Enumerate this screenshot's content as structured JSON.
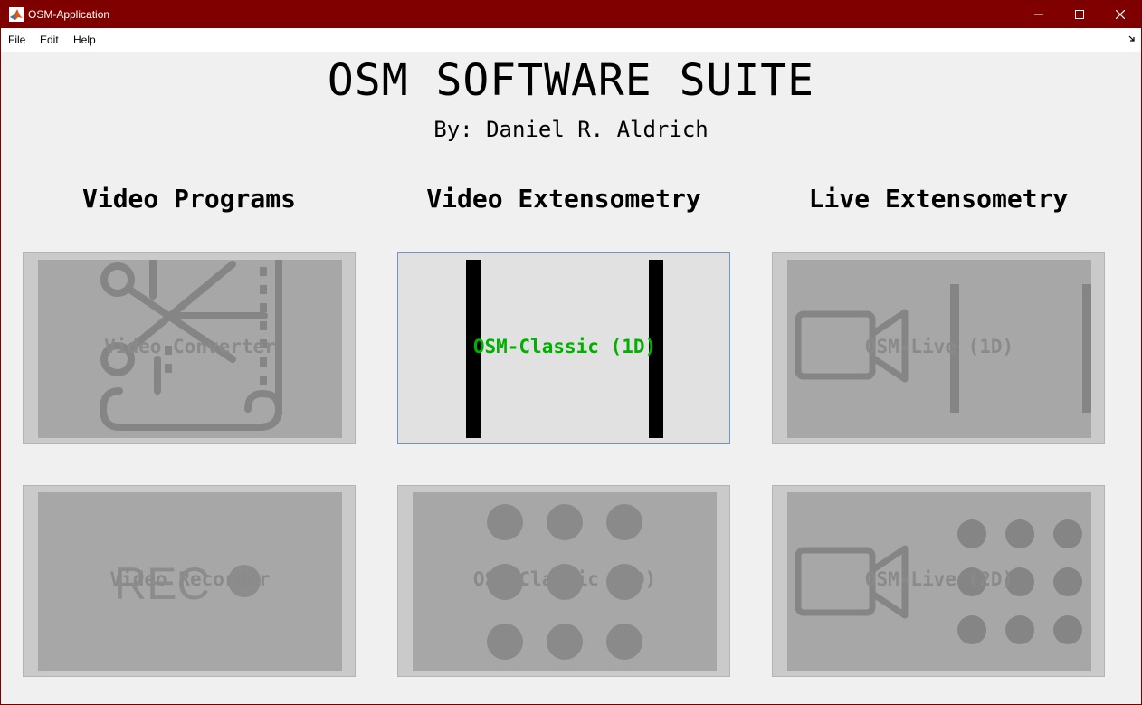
{
  "window": {
    "title": "OSM-Application"
  },
  "menu": {
    "items": [
      "File",
      "Edit",
      "Help"
    ]
  },
  "header": {
    "title": "OSM SOFTWARE SUITE",
    "subtitle": "By: Daniel R. Aldrich"
  },
  "columns": [
    {
      "heading": "Video Programs",
      "tiles": [
        {
          "label": "Video Converter",
          "icon": "video-converter-icon",
          "enabled": false
        },
        {
          "label": "Video Recorder",
          "icon": "rec-icon",
          "icon_text": "REC",
          "enabled": false
        }
      ]
    },
    {
      "heading": "Video Extensometry",
      "tiles": [
        {
          "label": "OSM-Classic (1D)",
          "icon": "two-markers-icon",
          "enabled": true
        },
        {
          "label": "OSM-Classic (2D)",
          "icon": "dot-grid-icon",
          "enabled": false
        }
      ]
    },
    {
      "heading": "Live Extensometry",
      "tiles": [
        {
          "label": "OSM-Live (1D)",
          "icon": "video-camera-markers-icon",
          "enabled": false
        },
        {
          "label": "OSM-Live (2D)",
          "icon": "video-camera-dots-icon",
          "enabled": false
        }
      ]
    }
  ],
  "colors": {
    "titlebar": "#800000",
    "active_label": "#00b000",
    "disabled_label": "#8a8a8a"
  }
}
